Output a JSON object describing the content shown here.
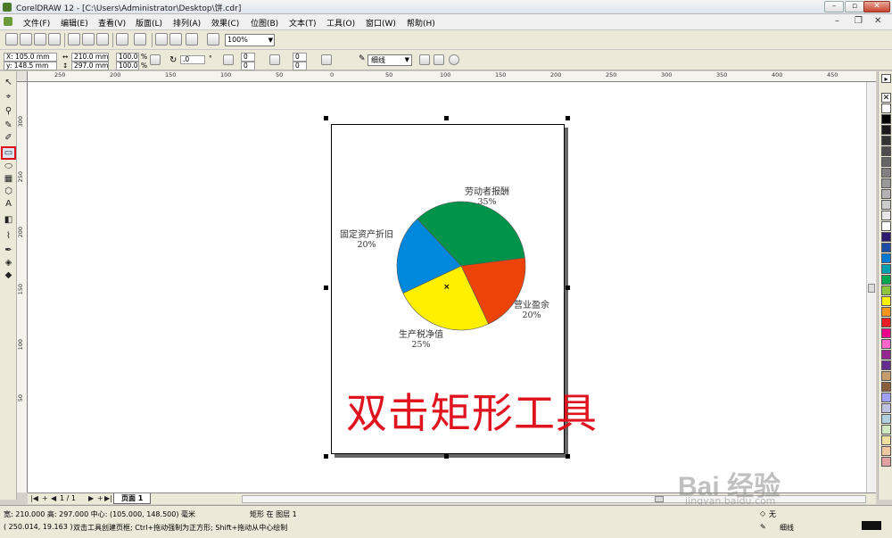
{
  "window": {
    "title": "CorelDRAW 12 - [C:\\Users\\Administrator\\Desktop\\饼.cdr]",
    "minimize": "–",
    "maximize": "▫",
    "close": "✕"
  },
  "menu": {
    "items": [
      "文件(F)",
      "编辑(E)",
      "查看(V)",
      "版面(L)",
      "排列(A)",
      "效果(C)",
      "位图(B)",
      "文本(T)",
      "工具(O)",
      "窗口(W)",
      "帮助(H)"
    ]
  },
  "toolbar": {
    "zoom": "100%"
  },
  "properties": {
    "x": "X: 105.0 mm",
    "y": "y: 148.5 mm",
    "width": "210.0 mm",
    "height": "297.0 mm",
    "scale_x": "100.0",
    "scale_y": "100.0",
    "pct": "%",
    "rotation": ".0",
    "degree": "°",
    "corner_1": "0",
    "corner_2": "0",
    "corner_3": "0",
    "corner_4": "0",
    "outline": "细线"
  },
  "rulers": {
    "h_ticks": [
      "250",
      "200",
      "150",
      "100",
      "50",
      "0",
      "50",
      "100",
      "150",
      "200",
      "250",
      "300",
      "350",
      "400",
      "450"
    ],
    "v_ticks": [
      "300",
      "250",
      "200",
      "150",
      "100",
      "50"
    ]
  },
  "chart_data": {
    "type": "pie",
    "title": "",
    "slices": [
      {
        "label": "劳动者报酬",
        "value": 35,
        "pct_text": "35%",
        "color": "#00944a"
      },
      {
        "label": "营业盈余",
        "value": 20,
        "pct_text": "20%",
        "color": "#ee4307"
      },
      {
        "label": "生产税净值",
        "value": 25,
        "pct_text": "25%",
        "color": "#fff000"
      },
      {
        "label": "固定资产折旧",
        "value": 20,
        "pct_text": "20%",
        "color": "#0088dd"
      }
    ]
  },
  "canvas": {
    "caption": "双击矩形工具"
  },
  "page_nav": {
    "counter": "1 / 1",
    "tab": "页面 1"
  },
  "status": {
    "line1": "宽: 210.000  高: 297.000  中心: (105.000, 148.500)  毫米",
    "object": "矩形 在 图层 1",
    "coords": "( 250.014, 19.163 )",
    "hint": "双击工具创建页框; Ctrl+拖动强制为正方形; Shift+拖动从中心绘制",
    "fill_label": "无",
    "outline_label": "细线"
  },
  "watermark": {
    "text": "Bai 经验",
    "sub": "jingyan.baidu.com"
  },
  "palette": [
    "#ffffff",
    "#000000",
    "#1a1a1a",
    "#333333",
    "#4d4d4d",
    "#666666",
    "#808080",
    "#999999",
    "#b3b3b3",
    "#cccccc",
    "#e6e6e6",
    "#ffffff",
    "#2e1a6e",
    "#1f4ea8",
    "#0078d4",
    "#00a0b0",
    "#00a651",
    "#8dc63f",
    "#fff200",
    "#f7941d",
    "#ed1c24",
    "#ec008c",
    "#ff66cc",
    "#92278f",
    "#662d91",
    "#c69c6d",
    "#8b5e3c",
    "#a0a0ff",
    "#c0c0e0",
    "#b0d0e0",
    "#d0e8c0",
    "#f0e0a0",
    "#f0c8a0",
    "#e0a0a0"
  ]
}
